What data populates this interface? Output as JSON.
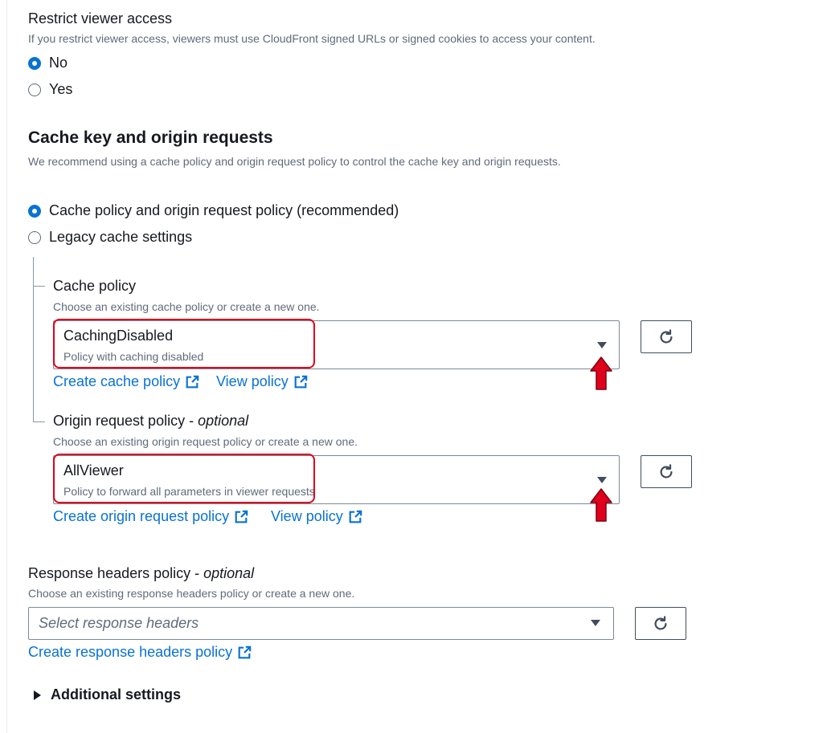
{
  "viewer_access": {
    "title": "Restrict viewer access",
    "description": "If you restrict viewer access, viewers must use CloudFront signed URLs or signed cookies to access your content.",
    "options": [
      {
        "label": "No",
        "checked": true
      },
      {
        "label": "Yes",
        "checked": false
      }
    ]
  },
  "cache_key": {
    "heading": "Cache key and origin requests",
    "description": "We recommend using a cache policy and origin request policy to control the cache key and origin requests.",
    "options": [
      {
        "label": "Cache policy and origin request policy (recommended)",
        "checked": true
      },
      {
        "label": "Legacy cache settings",
        "checked": false
      }
    ]
  },
  "cache_policy": {
    "label": "Cache policy",
    "description": "Choose an existing cache policy or create a new one.",
    "selected_value": "CachingDisabled",
    "selected_description": "Policy with caching disabled",
    "create_link": "Create cache policy",
    "view_link": "View policy"
  },
  "origin_request_policy": {
    "label": "Origin request policy - ",
    "label_optional": "optional",
    "description": "Choose an existing origin request policy or create a new one.",
    "selected_value": "AllViewer",
    "selected_description": "Policy to forward all parameters in viewer requests",
    "create_link": "Create origin request policy",
    "view_link": "View policy"
  },
  "response_headers_policy": {
    "label": "Response headers policy - ",
    "label_optional": "optional",
    "description": "Choose an existing response headers policy or create a new one.",
    "placeholder": "Select response headers",
    "create_link": "Create response headers policy"
  },
  "additional_settings": {
    "label": "Additional settings"
  },
  "icons": {
    "refresh": "refresh-icon",
    "external_link": "external-link-icon",
    "dropdown": "caret-down-icon",
    "annotation": "red-arrow-icon"
  },
  "colors": {
    "link": "#0972d3",
    "radio_checked": "#0972d3",
    "annotation": "#e0001b",
    "text": "#16191f",
    "secondary_text": "#5f6b7a"
  }
}
